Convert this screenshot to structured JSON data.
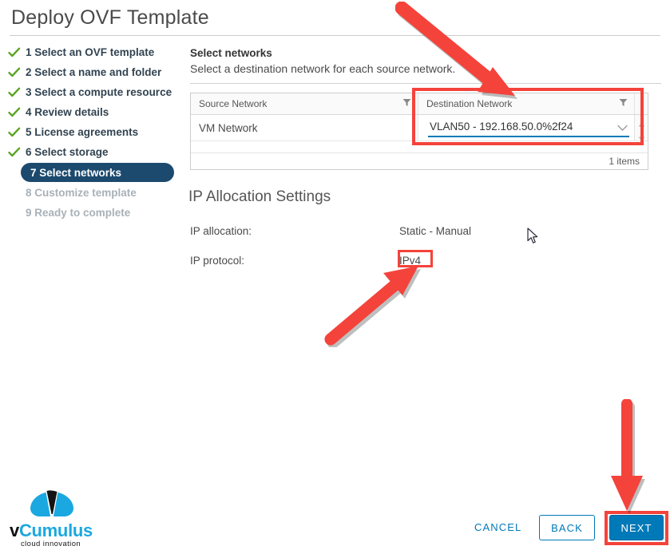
{
  "window": {
    "title": "Deploy OVF Template"
  },
  "steps": [
    {
      "num": "1",
      "label": "1 Select an OVF template",
      "state": "done"
    },
    {
      "num": "2",
      "label": "2 Select a name and folder",
      "state": "done"
    },
    {
      "num": "3",
      "label": "3 Select a compute resource",
      "state": "done"
    },
    {
      "num": "4",
      "label": "4 Review details",
      "state": "done"
    },
    {
      "num": "5",
      "label": "5 License agreements",
      "state": "done"
    },
    {
      "num": "6",
      "label": "6 Select storage",
      "state": "done"
    },
    {
      "num": "7",
      "label": "7 Select networks",
      "state": "active"
    },
    {
      "num": "8",
      "label": "8 Customize template",
      "state": "pending"
    },
    {
      "num": "9",
      "label": "9 Ready to complete",
      "state": "pending"
    }
  ],
  "panel": {
    "heading": "Select networks",
    "description": "Select a destination network for each source network."
  },
  "network_table": {
    "columns": [
      "Source Network",
      "Destination Network"
    ],
    "rows": [
      {
        "source": "VM Network",
        "destination": "VLAN50 - 192.168.50.0%2f24"
      }
    ],
    "footer_count": "1 items"
  },
  "ip_allocation": {
    "section_title": "IP Allocation Settings",
    "allocation_label": "IP allocation:",
    "allocation_value": "Static - Manual",
    "protocol_label": "IP protocol:",
    "protocol_value": "IPv4"
  },
  "footer": {
    "cancel_label": "CANCEL",
    "back_label": "BACK",
    "next_label": "NEXT"
  },
  "logo": {
    "word_prefix": "v",
    "word_main": "Cumulus",
    "tagline": "cloud innovation"
  },
  "colors": {
    "accent_blue": "#0079b8",
    "active_step": "#1c4a6e",
    "check_green": "#5ba524",
    "annotation_red": "#f4433b",
    "logo_cyan": "#1ba8e0"
  },
  "icons": {
    "check": "check-icon",
    "filter": "filter-icon",
    "chevron_down": "chevron-down-icon",
    "scroll_up": "scroll-up-arrow-icon",
    "scroll_down": "scroll-down-arrow-icon",
    "cursor": "mouse-cursor-icon"
  }
}
